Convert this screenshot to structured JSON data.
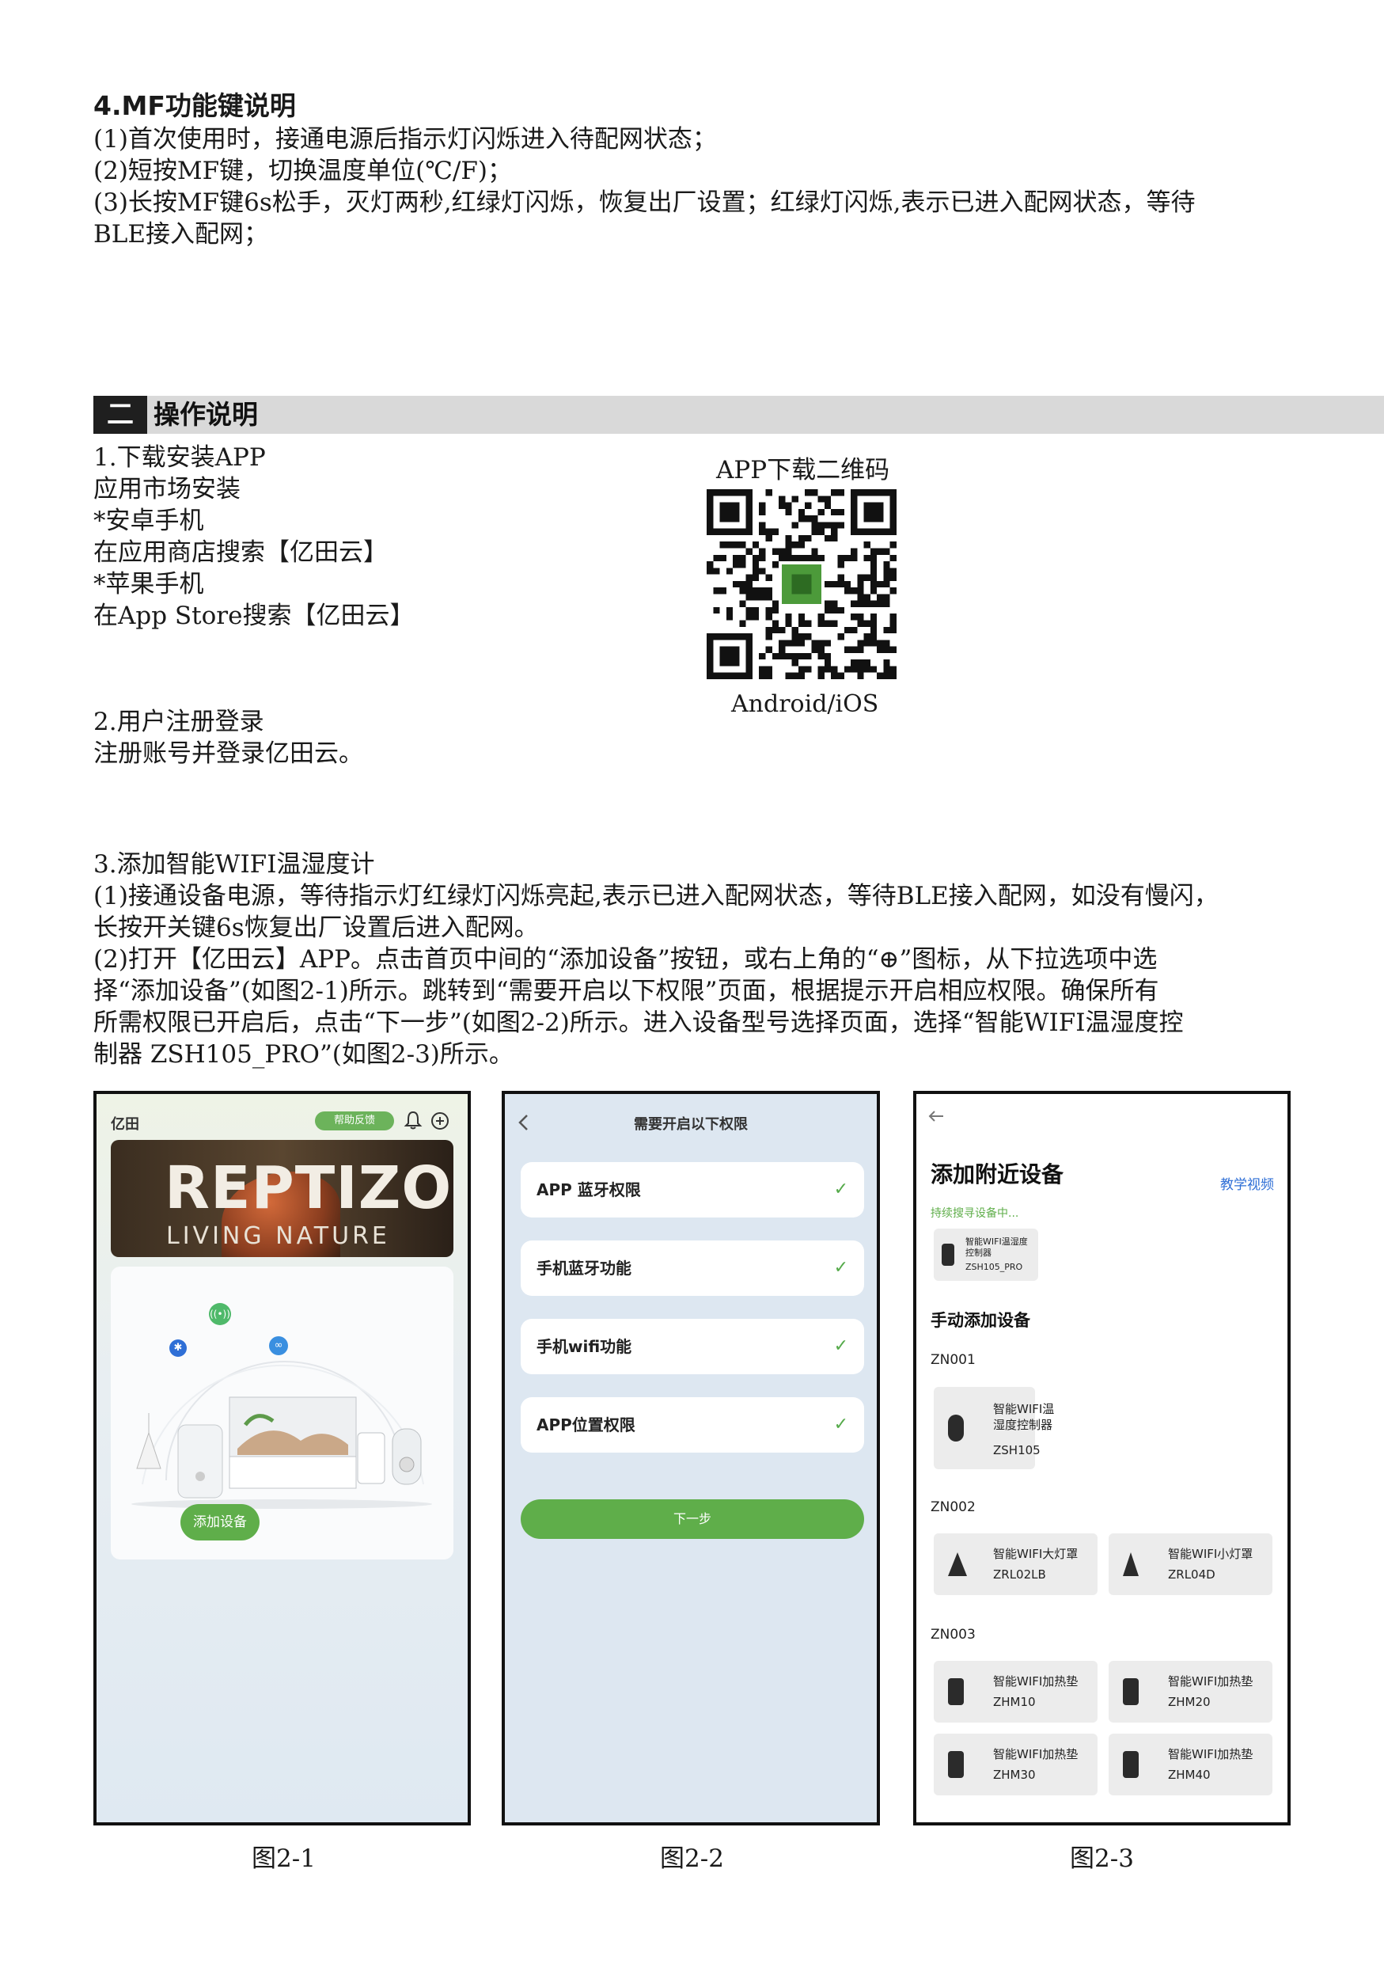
{
  "mf": {
    "heading": "4.MF功能键说明",
    "lines": [
      "(1)首次使用时，接通电源后指示灯闪烁进入待配网状态；",
      "(2)短按MF键，切换温度单位(℃/F)；",
      "(3)长按MF键6s松手，灭灯两秒,红绿灯闪烁，恢复出厂设置；红绿灯闪烁,表示已进入配网状态，等待",
      "BLE接入配网；"
    ]
  },
  "section": {
    "number": "二",
    "title": "操作说明"
  },
  "step1": {
    "lines": [
      "1.下载安装APP",
      "应用市场安装",
      "*安卓手机",
      "在应用商店搜索【亿田云】",
      "*苹果手机",
      "在App Store搜索【亿田云】"
    ]
  },
  "qr": {
    "title": "APP下载二维码",
    "caption": "Android/iOS"
  },
  "step2": {
    "lines": [
      "2.用户注册登录",
      "注册账号并登录亿田云。"
    ]
  },
  "step3": {
    "title": "3.添加智能WIFI温湿度计",
    "para1": [
      "(1)接通设备电源，等待指示灯红绿灯闪烁亮起,表示已进入配网状态，等待BLE接入配网，如没有慢闪，",
      "长按开关键6s恢复出厂设置后进入配网。"
    ],
    "para2": [
      "(2)打开【亿田云】APP。点击首页中间的“添加设备”按钮，或右上角的“⊕”图标，从下拉选项中选",
      "择“添加设备”(如图2-1)所示。跳转到“需要开启以下权限”页面，根据提示开启相应权限。确保所有",
      "所需权限已开启后，点击“下一步”(如图2-2)所示。进入设备型号选择页面，选择“智能WIFI温湿度控",
      "制器 ZSH105_PRO”(如图2-3)所示。"
    ]
  },
  "phone1": {
    "app_name": "亿田",
    "help_badge": "帮助反馈",
    "banner_text": "REPTIZOO",
    "banner_sub": "LIVING NATURE",
    "add_button": "添加设备",
    "caption": "图2-1"
  },
  "phone2": {
    "title": "需要开启以下权限",
    "permissions": [
      "APP 蓝牙权限",
      "手机蓝牙功能",
      "手机wifi功能",
      "APP位置权限"
    ],
    "next_button": "下一步",
    "caption": "图2-2"
  },
  "phone3": {
    "title": "添加附近设备",
    "tutorial": "教学视频",
    "searching": "持续搜寻设备中...",
    "nearby_device": {
      "name": "智能WIFI温湿度控制器",
      "model": "ZSH105_PRO"
    },
    "manual_title": "手动添加设备",
    "groups": [
      {
        "code": "ZN001",
        "items": [
          {
            "name": "智能WIFI温湿度控制器",
            "model": "ZSH105"
          }
        ]
      },
      {
        "code": "ZN002",
        "items": [
          {
            "name": "智能WIFI大灯罩",
            "model": "ZRL02LB"
          },
          {
            "name": "智能WIFI小灯罩",
            "model": "ZRL04D"
          }
        ]
      },
      {
        "code": "ZN003",
        "items": [
          {
            "name": "智能WIFI加热垫",
            "model": "ZHM10"
          },
          {
            "name": "智能WIFI加热垫",
            "model": "ZHM20"
          },
          {
            "name": "智能WIFI加热垫",
            "model": "ZHM30"
          },
          {
            "name": "智能WIFI加热垫",
            "model": "ZHM40"
          }
        ]
      }
    ],
    "caption": "图2-3"
  },
  "icons": [
    "bell-icon",
    "plus-circle-icon",
    "back-chevron-icon",
    "checkmark-icon",
    "bluetooth-icon",
    "link-icon",
    "wireless-icon"
  ],
  "colors": {
    "accent_green": "#5fae4a",
    "section_bar": "#d9d9d9",
    "section_num": "#1f1f1f"
  }
}
